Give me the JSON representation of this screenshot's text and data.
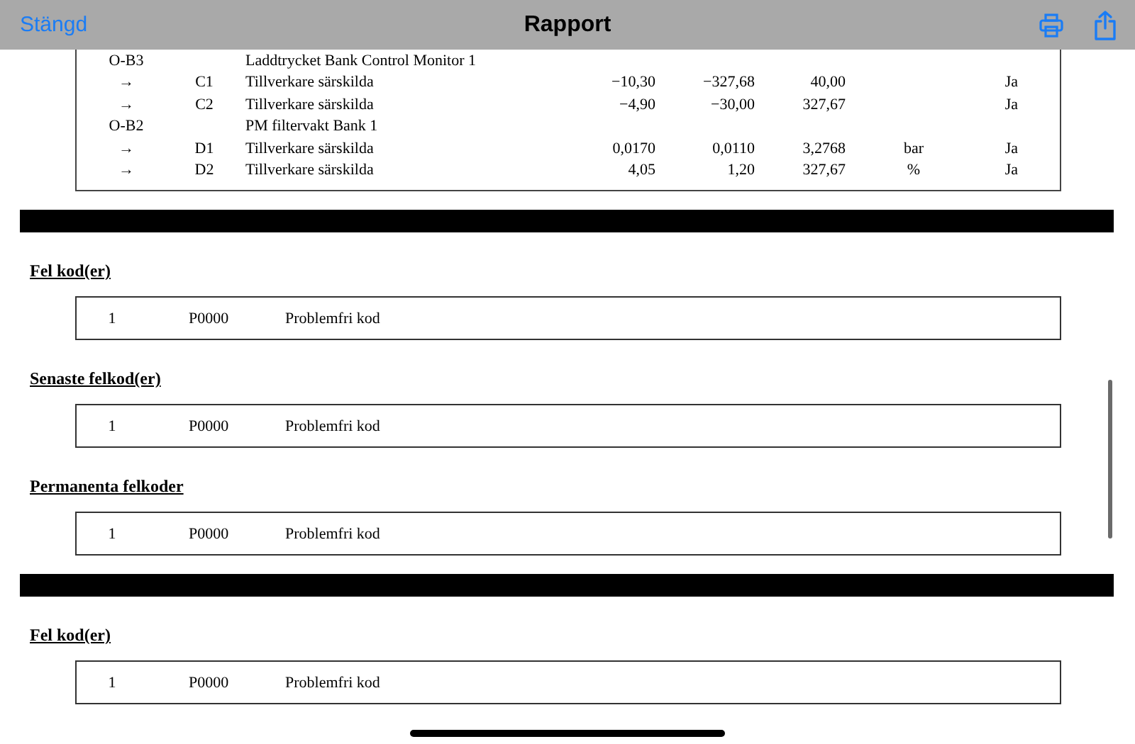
{
  "toolbar": {
    "close": "Stängd",
    "title": "Rapport"
  },
  "parameter_table": {
    "rows": [
      {
        "col1": "O-B3",
        "description": "Laddtrycket Bank Control Monitor 1"
      },
      {
        "col1": "→",
        "col2": "C1",
        "description": "Tillverkare särskilda",
        "value_1": "−10,30",
        "value_2": "−327,68",
        "value_3": "40,00",
        "col8": "Ja"
      },
      {
        "col1": "→",
        "col2": "C2",
        "description": "Tillverkare särskilda",
        "value_1": "−4,90",
        "value_2": "−30,00",
        "value_3": "327,67",
        "col8": "Ja"
      },
      {
        "col1": "O-B2",
        "description": "PM filtervakt Bank 1"
      },
      {
        "col1": "→",
        "col2": "D1",
        "description": "Tillverkare särskilda",
        "value_1": "0,0170",
        "value_2": "0,0110",
        "value_3": "3,2768",
        "unit": "bar",
        "col8": "Ja"
      },
      {
        "col1": "→",
        "col2": "D2",
        "description": "Tillverkare särskilda",
        "value_1": "4,05",
        "value_2": "1,20",
        "value_3": "327,67",
        "unit": "%",
        "col8": "Ja"
      }
    ]
  },
  "sections": [
    {
      "kind": "divider"
    },
    {
      "kind": "codes",
      "heading": "Fel kod(er)",
      "rows": [
        {
          "index": "1",
          "code": "P0000",
          "description": "Problemfri kod"
        }
      ]
    },
    {
      "kind": "codes",
      "heading": "Senaste felkod(er)",
      "rows": [
        {
          "index": "1",
          "code": "P0000",
          "description": "Problemfri kod"
        }
      ]
    },
    {
      "kind": "codes",
      "heading": "Permanenta felkoder",
      "rows": [
        {
          "index": "1",
          "code": "P0000",
          "description": "Problemfri kod"
        }
      ]
    },
    {
      "kind": "divider"
    },
    {
      "kind": "codes",
      "heading": "Fel kod(er)",
      "rows": [
        {
          "index": "1",
          "code": "P0000",
          "description": "Problemfri kod"
        }
      ]
    }
  ]
}
